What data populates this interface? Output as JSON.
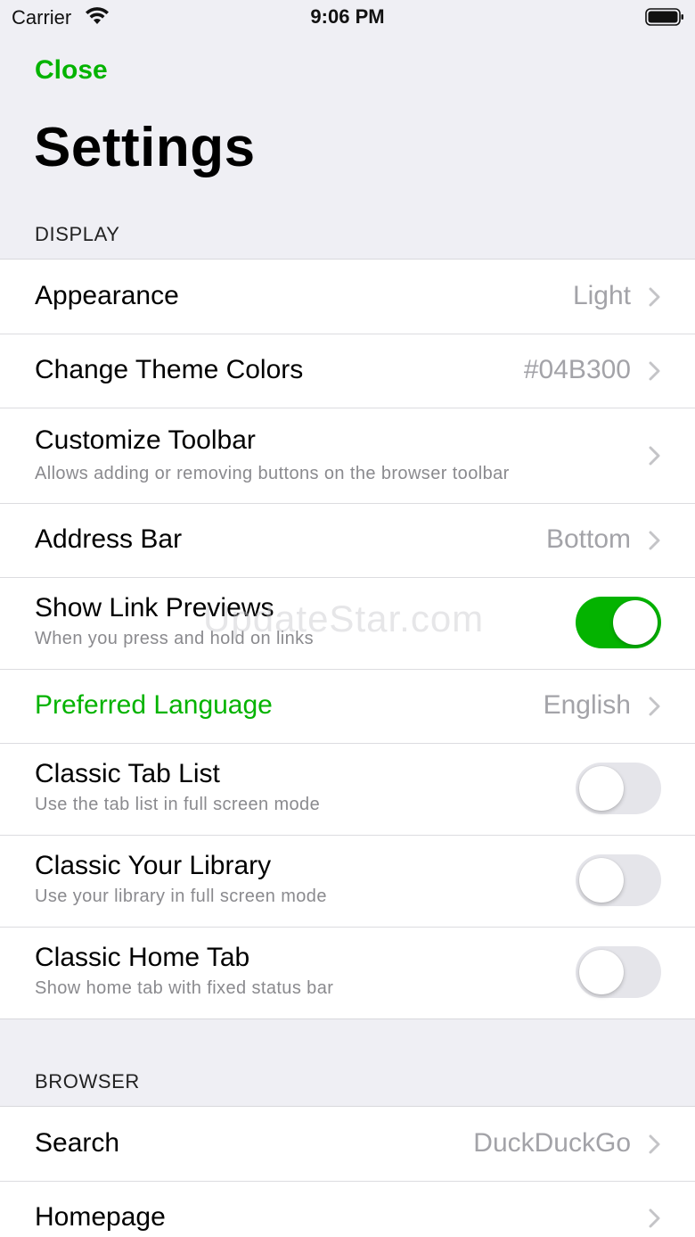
{
  "status_bar": {
    "carrier": "Carrier",
    "time": "9:06 PM"
  },
  "nav": {
    "close_label": "Close",
    "title": "Settings"
  },
  "colors": {
    "accent": "#04B300",
    "toggle_off": "#E5E5EA",
    "value_text": "#A3A3A8"
  },
  "sections": {
    "display": {
      "header": "DISPLAY",
      "rows": [
        {
          "title": "Appearance",
          "value": "Light"
        },
        {
          "title": "Change Theme Colors",
          "value": "#04B300"
        },
        {
          "title": "Customize Toolbar",
          "subtitle": "Allows adding or removing buttons on the browser toolbar"
        },
        {
          "title": "Address Bar",
          "value": "Bottom"
        },
        {
          "title": "Show Link Previews",
          "subtitle": "When you press and hold on links",
          "toggle": true
        },
        {
          "title": "Preferred Language",
          "value": "English"
        },
        {
          "title": "Classic Tab List",
          "subtitle": "Use the tab list in full screen mode",
          "toggle": false
        },
        {
          "title": "Classic Your Library",
          "subtitle": "Use your library in full screen mode",
          "toggle": false
        },
        {
          "title": "Classic Home Tab",
          "subtitle": "Show home tab with fixed status bar",
          "toggle": false
        }
      ]
    },
    "browser": {
      "header": "BROWSER",
      "rows": [
        {
          "title": "Search",
          "value": "DuckDuckGo"
        },
        {
          "title": "Homepage",
          "value": ""
        }
      ]
    }
  },
  "watermark": "UpdateStar.com"
}
